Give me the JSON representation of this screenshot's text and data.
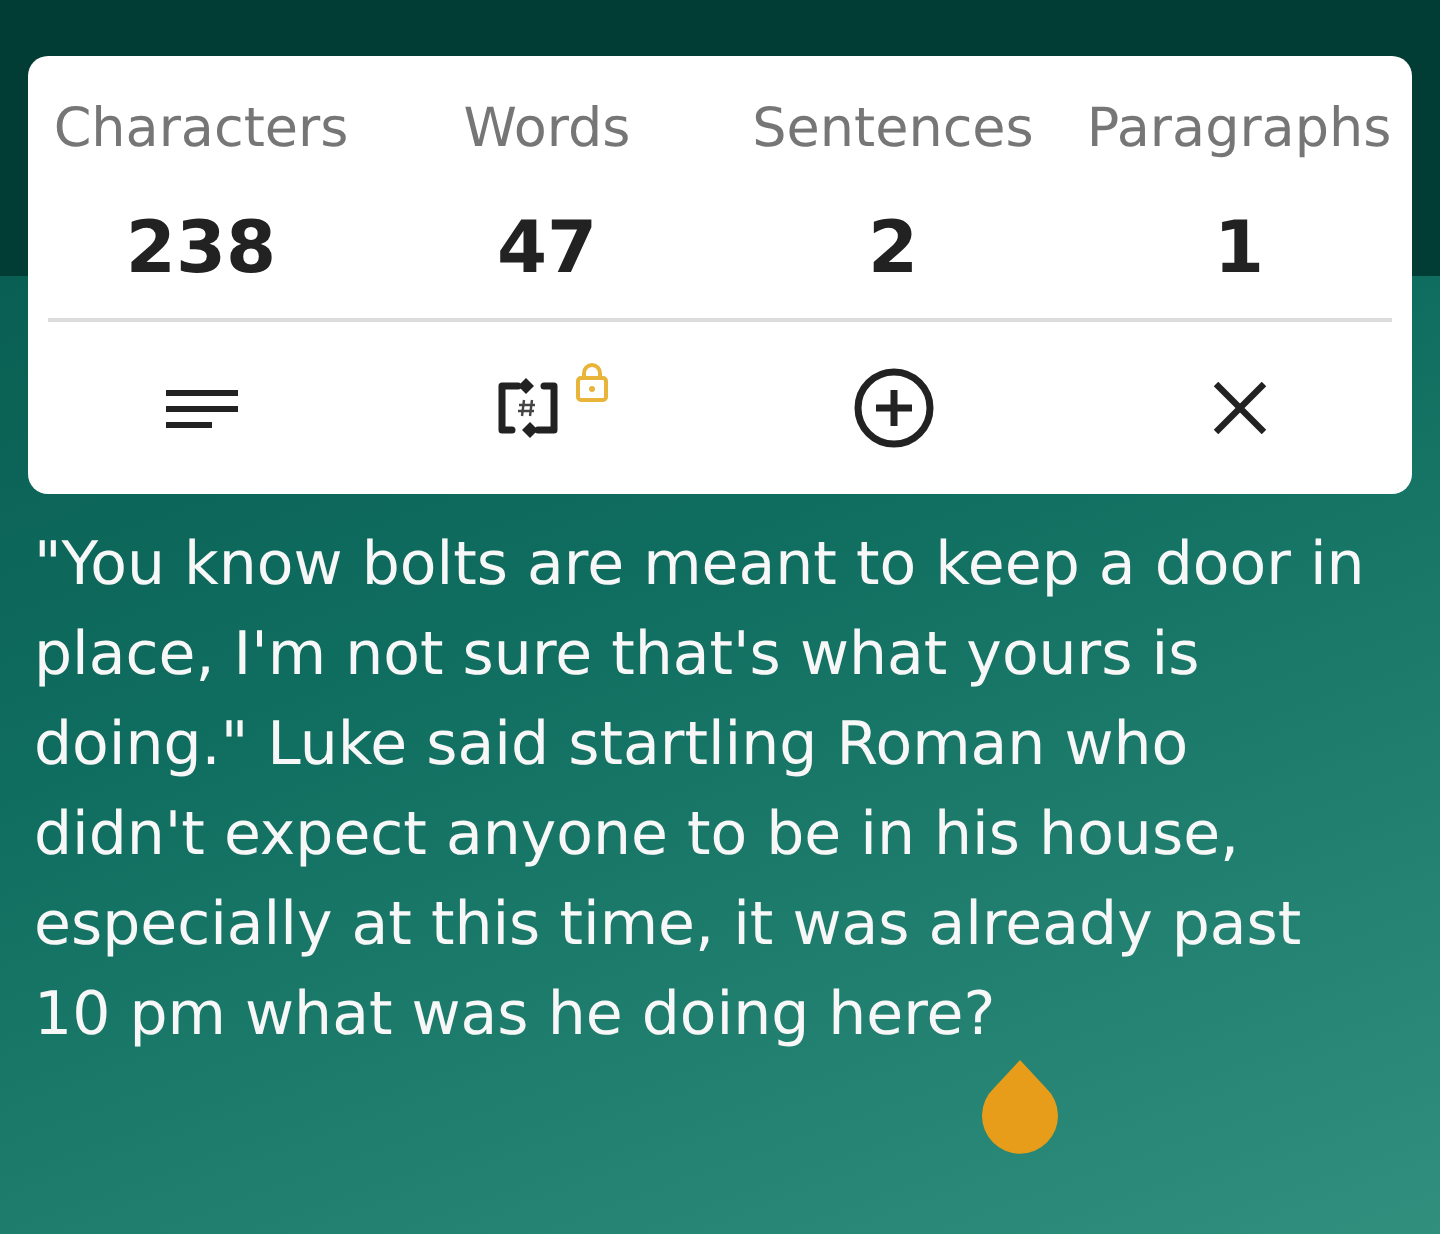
{
  "stats": [
    {
      "label": "Characters",
      "value": "238"
    },
    {
      "label": "Words",
      "value": "47"
    },
    {
      "label": "Sentences",
      "value": "2"
    },
    {
      "label": "Paragraphs",
      "value": "1"
    }
  ],
  "toolbar": [
    {
      "kind": "lines",
      "locked": false
    },
    {
      "kind": "counter",
      "locked": true
    },
    {
      "kind": "add",
      "locked": false
    },
    {
      "kind": "close",
      "locked": false
    }
  ],
  "body_text_lines": [
    "\"You know bolts are meant to keep a door in",
    "place, I'm not sure that's what yours is",
    "doing.\" Luke said startling Roman who",
    "didn't expect anyone to be in his house,",
    "especially at this time, it was already past",
    "10 pm what was he doing here?"
  ]
}
